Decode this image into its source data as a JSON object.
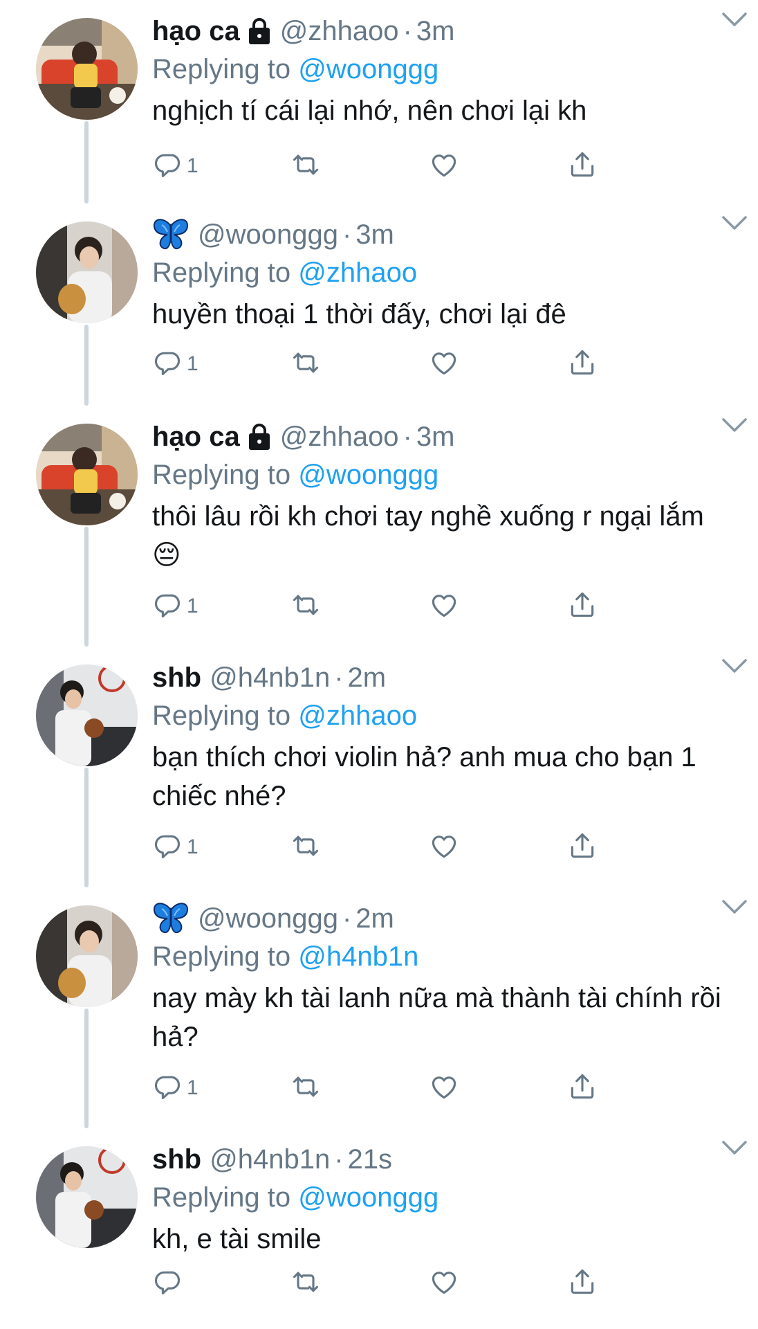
{
  "tweets": [
    {
      "name": "hạo ca",
      "locked": true,
      "butterfly": false,
      "handle": "@zhhaoo",
      "time": "3m",
      "replying_label": "Replying to",
      "replying_to": "@woonggg",
      "text": "nghịch tí cái lại nhớ, nên chơi lại kh",
      "reply_count": "1",
      "avatar": "avatar-haoca"
    },
    {
      "name": "",
      "locked": false,
      "butterfly": true,
      "handle": "@woonggg",
      "time": "3m",
      "replying_label": "Replying to",
      "replying_to": "@zhhaoo",
      "text": "huyền thoại 1 thời đấy, chơi lại đê",
      "reply_count": "1",
      "avatar": "avatar-woonggg"
    },
    {
      "name": "hạo ca",
      "locked": true,
      "butterfly": false,
      "handle": "@zhhaoo",
      "time": "3m",
      "replying_label": "Replying to",
      "replying_to": "@woonggg",
      "text": "thôi lâu rồi kh chơi tay nghề xuống r ngại lắm 😔",
      "reply_count": "1",
      "avatar": "avatar-haoca"
    },
    {
      "name": "shb",
      "locked": false,
      "butterfly": false,
      "handle": "@h4nb1n",
      "time": "2m",
      "replying_label": "Replying to",
      "replying_to": "@zhhaoo",
      "text": "bạn thích chơi violin hả? anh mua cho bạn 1 chiếc nhé?",
      "reply_count": "1",
      "avatar": "avatar-shb"
    },
    {
      "name": "",
      "locked": false,
      "butterfly": true,
      "handle": "@woonggg",
      "time": "2m",
      "replying_label": "Replying to",
      "replying_to": "@h4nb1n",
      "text": "nay mày kh tài lanh nữa mà thành tài chính rồi hả?",
      "reply_count": "1",
      "avatar": "avatar-woonggg"
    },
    {
      "name": "shb",
      "locked": false,
      "butterfly": false,
      "handle": "@h4nb1n",
      "time": "21s",
      "replying_label": "Replying to",
      "replying_to": "@woonggg",
      "text": "kh, e tài smile",
      "reply_count": "",
      "avatar": "avatar-shb"
    }
  ],
  "colors": {
    "text": "#14171a",
    "muted": "#657786",
    "link": "#1da1f2",
    "thread_line": "#ccd6dd",
    "butterfly": "#1d7ee0"
  },
  "icons": [
    "reply-icon",
    "retweet-icon",
    "like-icon",
    "share-icon",
    "chevron-down-icon",
    "lock-icon",
    "butterfly-emoji"
  ]
}
